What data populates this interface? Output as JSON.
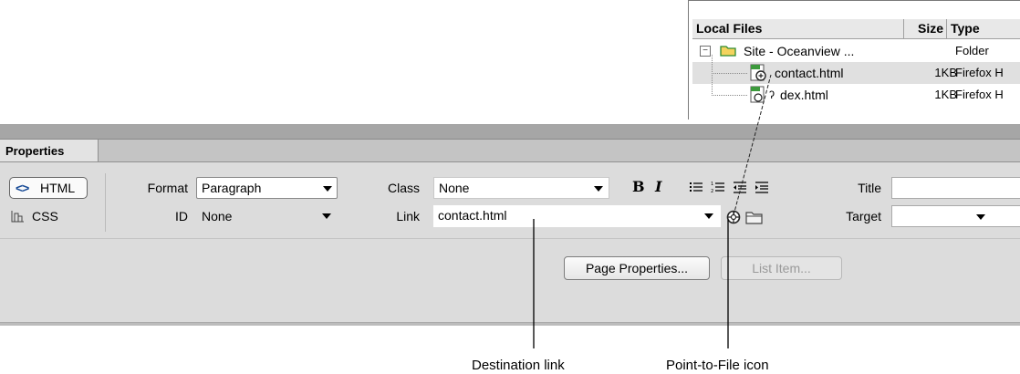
{
  "files_panel": {
    "columns": {
      "name": "Local Files",
      "size": "Size",
      "type": "Type"
    },
    "rows": [
      {
        "name": "Site - Oceanview ...",
        "size": "",
        "type": "Folder"
      },
      {
        "name": "contact.html",
        "size": "1KB",
        "type": "Firefox H"
      },
      {
        "name": "dex.html",
        "size": "1KB",
        "type": "Firefox H"
      }
    ],
    "expander_symbol": "−"
  },
  "properties": {
    "tab_label": "Properties",
    "html_button": {
      "icon": "<>",
      "label": "HTML"
    },
    "css_button": {
      "icon": "css-grid-icon",
      "label": "CSS"
    },
    "format": {
      "label": "Format",
      "value": "Paragraph"
    },
    "id": {
      "label": "ID",
      "value": "None"
    },
    "class": {
      "label": "Class",
      "value": "None"
    },
    "link": {
      "label": "Link",
      "value": "contact.html"
    },
    "bold_label": "B",
    "italic_label": "I",
    "title": {
      "label": "Title",
      "value": ""
    },
    "target": {
      "label": "Target",
      "value": ""
    },
    "page_properties_button": "Page Properties...",
    "list_item_button": "List Item..."
  },
  "callouts": {
    "destination_link": "Destination link",
    "point_to_file": "Point-to-File icon"
  }
}
